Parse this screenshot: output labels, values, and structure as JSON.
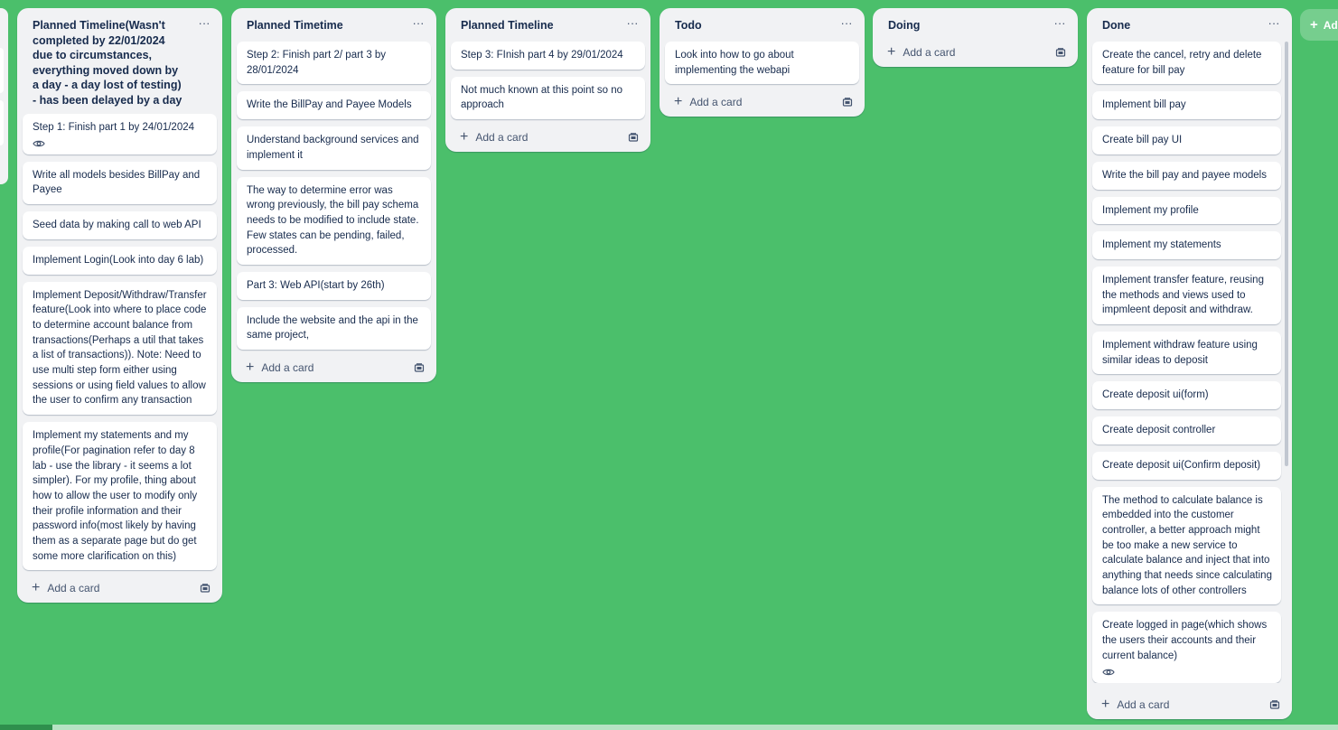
{
  "icons": {
    "menu": "ellipsis-icon",
    "add": "plus-icon",
    "template": "card-template-icon",
    "eye": "eye-icon"
  },
  "colors": {
    "board_background": "#4bbf6b",
    "list_background": "#f1f2f4",
    "card_background": "#ffffff"
  },
  "lists": [
    {
      "title": "Planned Timeline(Wasn't completed by 22/01/2024 due to circumstances, everything moved down by a day - a day lost of testing) - has been delayed by a day",
      "menu": "···",
      "cards": [
        {
          "text": "Step 1: Finish part 1 by 24/01/2024",
          "eye": true
        },
        {
          "text": "Write all models besides BillPay and Payee"
        },
        {
          "text": "Seed data by making call to web API"
        },
        {
          "text": "Implement Login(Look into day 6 lab)"
        },
        {
          "text": "Implement Deposit/Withdraw/Transfer feature(Look into where to place code to determine account balance from transactions(Perhaps a util that takes a list of transactions)). Note: Need to use multi step form either using sessions or using field values to allow the user to confirm any transaction"
        },
        {
          "text": "Implement my statements and my profile(For pagination refer to day 8 lab - use the library - it seems a lot simpler). For my profile, thing about how to allow the user to modify only their profile information and their password info(most likely by having them as a separate page but do get some more clarification on this)"
        }
      ],
      "add_label": "Add a card"
    },
    {
      "title": "Planned Timetime",
      "menu": "···",
      "cards": [
        {
          "text": "Step 2: Finish part 2/ part 3 by 28/01/2024"
        },
        {
          "text": "Write the BillPay and Payee Models"
        },
        {
          "text": "Understand background services and implement it"
        },
        {
          "text": "The way to determine error was wrong previously, the bill pay schema needs to be modified to include state. Few states can be pending, failed, processed."
        },
        {
          "text": "Part 3: Web API(start by 26th)"
        },
        {
          "text": "Include the website and the api in the same project,"
        }
      ],
      "add_label": "Add a card"
    },
    {
      "title": "Planned Timeline",
      "menu": "···",
      "cards": [
        {
          "text": "Step 3: FInish part 4 by 29/01/2024"
        },
        {
          "text": "Not much known at this point so no approach"
        }
      ],
      "add_label": "Add a card"
    },
    {
      "title": "Todo",
      "menu": "···",
      "cards": [
        {
          "text": "Look into how to go about implementing the webapi"
        }
      ],
      "add_label": "Add a card"
    },
    {
      "title": "Doing",
      "menu": "···",
      "cards": [],
      "add_label": "Add a card"
    },
    {
      "title": "Done",
      "menu": "···",
      "cards": [
        {
          "text": "Create the cancel, retry and delete feature for bill pay"
        },
        {
          "text": "Implement bill pay"
        },
        {
          "text": "Create bill pay UI"
        },
        {
          "text": "Write the bill pay and payee models"
        },
        {
          "text": "Implement my profile"
        },
        {
          "text": "Implement my statements"
        },
        {
          "text": "Implement transfer feature, reusing the methods and views used to impmleent deposit and withdraw."
        },
        {
          "text": "Implement withdraw feature using similar ideas to deposit"
        },
        {
          "text": "Create deposit ui(form)"
        },
        {
          "text": "Create deposit controller"
        },
        {
          "text": "Create deposit ui(Confirm deposit)"
        },
        {
          "text": "The method to calculate balance is embedded into the customer controller, a better approach might be too make a new service to calculate balance and inject that into anything that needs since calculating balance lots of other controllers"
        },
        {
          "text": "Create logged in page(which shows the users their accounts and their current balance)",
          "eye": true
        }
      ],
      "add_label": "Add a card"
    }
  ],
  "add_list_label": "Ad"
}
